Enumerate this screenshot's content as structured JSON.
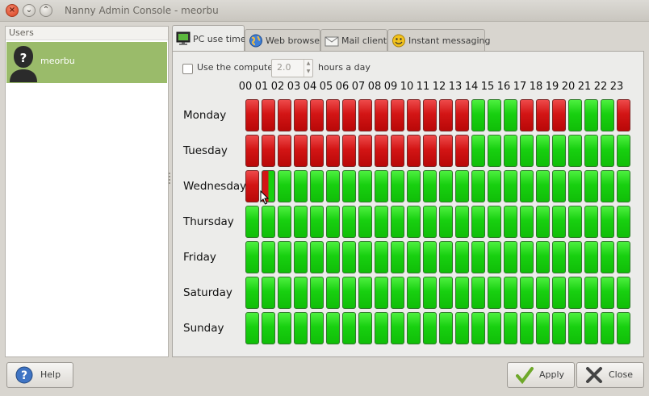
{
  "window": {
    "title": "Nanny Admin Console - meorbu"
  },
  "users": {
    "header": "Users",
    "items": [
      {
        "name": "meorbu"
      }
    ]
  },
  "tabs": [
    {
      "label": "PC use time",
      "icon": "monitor-icon",
      "active": true
    },
    {
      "label": "Web browser",
      "icon": "globe-icon",
      "active": false
    },
    {
      "label": "Mail client",
      "icon": "mail-icon",
      "active": false
    },
    {
      "label": "Instant messaging",
      "icon": "smiley-icon",
      "active": false
    }
  ],
  "pc_use": {
    "use_computer_label": "Use the computer",
    "use_computer_checked": false,
    "hours_value": "2.0",
    "hours_suffix": "hours a day"
  },
  "schedule": {
    "hours": [
      "00",
      "01",
      "02",
      "03",
      "04",
      "05",
      "06",
      "07",
      "08",
      "09",
      "10",
      "11",
      "12",
      "13",
      "14",
      "15",
      "16",
      "17",
      "18",
      "19",
      "20",
      "21",
      "22",
      "23"
    ],
    "days": [
      {
        "name": "Monday",
        "blocked_hours": [
          0,
          1,
          2,
          3,
          4,
          5,
          6,
          7,
          8,
          9,
          10,
          11,
          12,
          13,
          17,
          18,
          19,
          23
        ]
      },
      {
        "name": "Tuesday",
        "blocked_hours": [
          0,
          1,
          2,
          3,
          4,
          5,
          6,
          7,
          8,
          9,
          10,
          11,
          12,
          13
        ]
      },
      {
        "name": "Wednesday",
        "blocked_hours": [
          0
        ],
        "partial_hours": [
          1
        ]
      },
      {
        "name": "Thursday",
        "blocked_hours": []
      },
      {
        "name": "Friday",
        "blocked_hours": []
      },
      {
        "name": "Saturday",
        "blocked_hours": []
      },
      {
        "name": "Sunday",
        "blocked_hours": []
      }
    ],
    "colors": {
      "allowed": "#18d010",
      "blocked": "#d31515"
    }
  },
  "buttons": {
    "help": "Help",
    "apply": "Apply",
    "close": "Close"
  }
}
